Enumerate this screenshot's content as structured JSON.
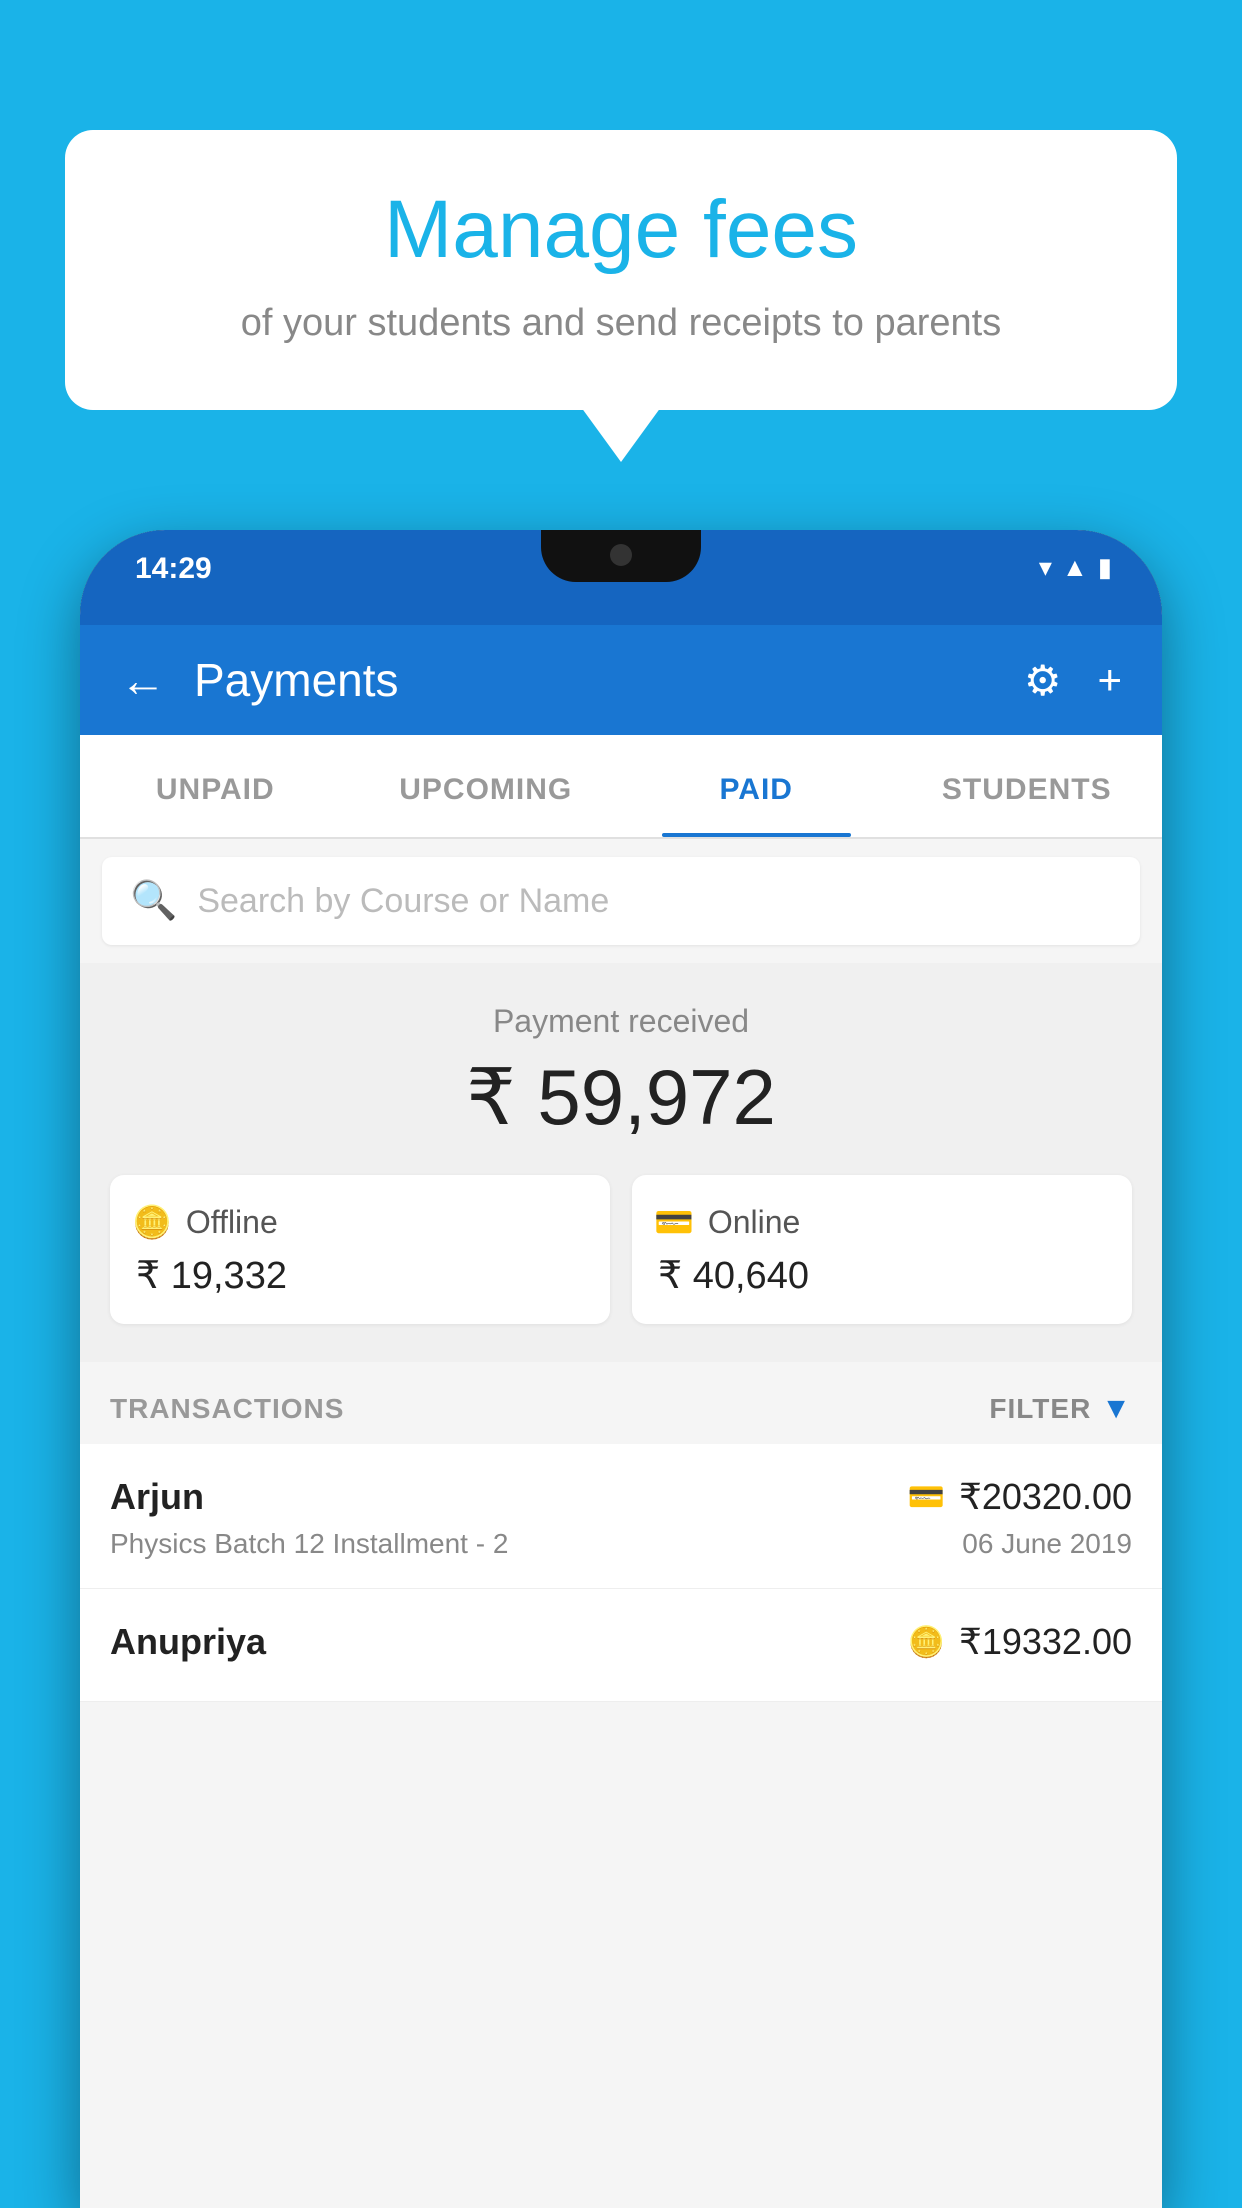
{
  "background_color": "#1ab3e8",
  "bubble": {
    "title": "Manage fees",
    "subtitle": "of your students and send receipts to parents"
  },
  "phone": {
    "status_time": "14:29",
    "app_bar": {
      "title": "Payments",
      "back_label": "←",
      "settings_icon": "⚙",
      "add_icon": "+"
    },
    "tabs": [
      {
        "label": "UNPAID",
        "active": false
      },
      {
        "label": "UPCOMING",
        "active": false
      },
      {
        "label": "PAID",
        "active": true
      },
      {
        "label": "STUDENTS",
        "active": false
      }
    ],
    "search": {
      "placeholder": "Search by Course or Name"
    },
    "payment_summary": {
      "label": "Payment received",
      "total": "₹ 59,972",
      "offline_label": "Offline",
      "offline_amount": "₹ 19,332",
      "online_label": "Online",
      "online_amount": "₹ 40,640"
    },
    "transactions": {
      "header": "TRANSACTIONS",
      "filter_label": "FILTER",
      "rows": [
        {
          "name": "Arjun",
          "course": "Physics Batch 12 Installment - 2",
          "amount": "₹20320.00",
          "date": "06 June 2019",
          "payment_type": "online"
        },
        {
          "name": "Anupriya",
          "course": "",
          "amount": "₹19332.00",
          "date": "",
          "payment_type": "offline"
        }
      ]
    }
  }
}
